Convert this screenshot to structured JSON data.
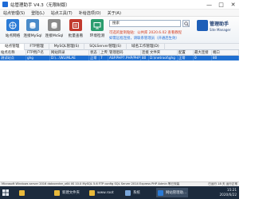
{
  "window": {
    "title": "站管理助手 V4.3（无限制版）",
    "controls": [
      "—",
      "□",
      "✕"
    ]
  },
  "menu": [
    "站点管理(S)",
    "登陆(L)",
    "站点工具(T)",
    "补给选项(O)",
    "关于(A)"
  ],
  "toolbar": {
    "buttons": [
      {
        "label": "站点网络",
        "icon": "site-network-icon",
        "color": "#2b7bd6"
      },
      {
        "label": "连接MySql",
        "icon": "mysql-icon",
        "color": "#4a8bc9"
      },
      {
        "label": "连接MsSql",
        "icon": "mssql-icon",
        "color": "#8a8a8a"
      },
      {
        "label": "批量查看",
        "icon": "batch-view-icon",
        "color": "#c23a2e"
      },
      {
        "label": "环境检测",
        "icon": "env-check-icon",
        "color": "#2a9c6e"
      }
    ],
    "search_value": "搜索",
    "notice": "可选的复制粘贴：公共库 2020.6.02 查看教程",
    "notice2": "如需远程连接，请联系管理员（开通后生效）"
  },
  "logo": {
    "cn": "管理助手",
    "en": "Site Manager"
  },
  "tabs": [
    "站点管理",
    "FTP管理",
    "MySQL管理(S)",
    "SQLServer管理(S)",
    "域名工作管理(D)"
  ],
  "table": {
    "columns": [
      "站点名称",
      "FTP用户名",
      "网站目录",
      "状态",
      "上传量",
      "管理密码",
      "连接",
      "文件夹",
      "配置",
      "最大连接",
      "端口"
    ],
    "rows": [
      [
        "测试站点",
        "ghg",
        "D:\\...\\WL\\MLAE",
        "正常",
        "7",
        "ASP.PHP7.PHP/PHP5",
        "80",
        "D:\\inetroot\\ghg",
        "正常",
        "0",
        "80"
      ]
    ]
  },
  "status": {
    "left": "Microsoft Windows server 2016 datacenter_x64 IIS 10.0 MySQL 5.6 FTP config SQL Server 2014 Express PHP Admin 等已安装",
    "right": "已运行 18 天 运行正常"
  },
  "taskbar": {
    "items": [
      {
        "label": "",
        "color": "#e8b93a"
      },
      {
        "label": "新建文件夹",
        "color": "#e8b93a"
      },
      {
        "label": "www.root",
        "color": "#e8b93a"
      },
      {
        "label": "系统",
        "color": "#7aa7dc"
      },
      {
        "label": "网站管理助...",
        "color": "#2b7bd6"
      }
    ],
    "time": "15:21",
    "date": "2020/6/22"
  }
}
